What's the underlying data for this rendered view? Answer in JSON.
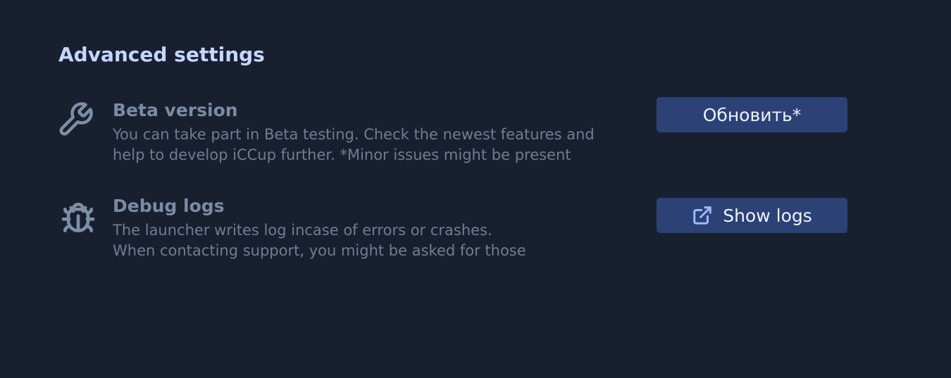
{
  "section": {
    "title": "Advanced settings"
  },
  "settings": {
    "beta": {
      "icon": "wrench-icon",
      "title": "Beta version",
      "description_line1": "You can take part in Beta testing. Check the newest features and",
      "description_line2": "help to develop iCCup further. *Minor issues might be present",
      "button_label": "Обновить*"
    },
    "debug": {
      "icon": "bug-icon",
      "title": "Debug logs",
      "description_line1": "The launcher writes log incase of errors or crashes.",
      "description_line2": "When contacting support, you might be asked for those",
      "button_icon": "external-link-icon",
      "button_label": "Show logs"
    }
  },
  "colors": {
    "background": "#182030",
    "title": "#c4d7ff",
    "button": "#2c4276",
    "muted_text": "#6f7d92"
  }
}
